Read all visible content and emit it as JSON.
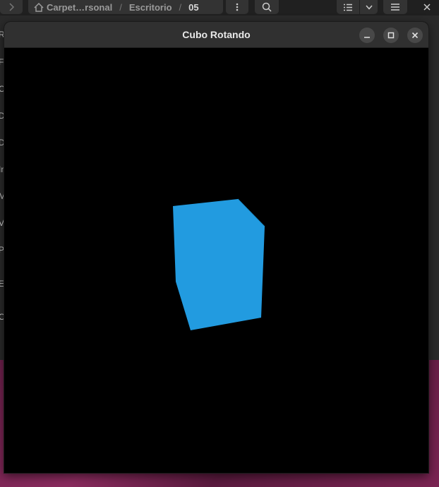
{
  "background_window": {
    "path": {
      "home_segment": "Carpet…rsonal",
      "separator": "/",
      "segment2": "Escritorio",
      "current": "05"
    },
    "sidebar_fragments": [
      "Re",
      "Fa",
      "C",
      "D",
      "D",
      "Im",
      "M",
      "V",
      "Pa",
      "Es",
      "O"
    ]
  },
  "window": {
    "title": "Cubo Rotando",
    "icons": {
      "minimize": "minimize-icon",
      "maximize": "maximize-icon",
      "close": "close-icon"
    }
  },
  "scene": {
    "background_color": "#000000",
    "cube_color": "#229be0",
    "cube_edge_color": "#1a8fd0"
  },
  "colors": {
    "titlebar": "#303030",
    "wallpaper": "#7a2452"
  }
}
